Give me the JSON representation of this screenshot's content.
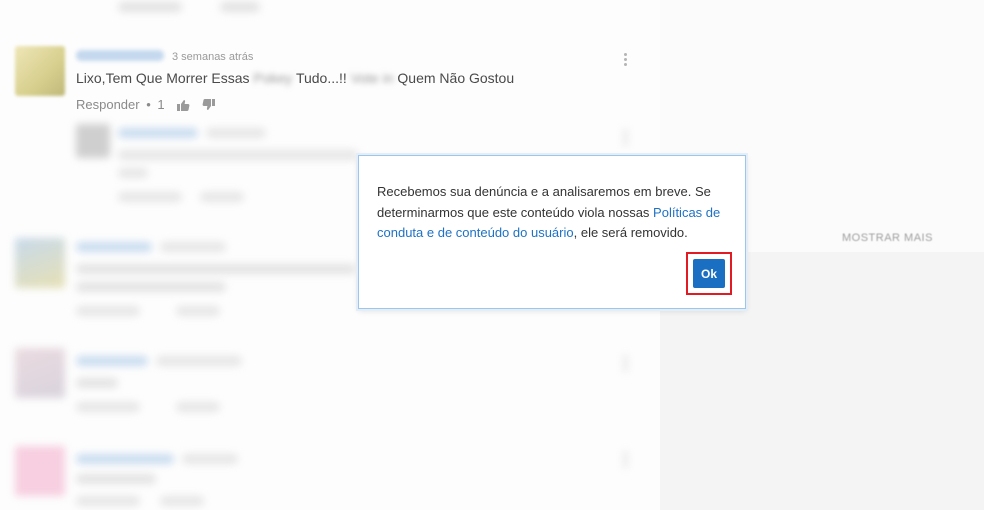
{
  "comment": {
    "time": "3 semanas atrás",
    "text_part1": "Lixo,Tem Que Morrer Essas",
    "text_hidden1": "Pokey",
    "text_part2": "Tudo...!!",
    "text_hidden2": "Vote in",
    "text_part3": "Quem Não Gostou",
    "reply_label": "Responder",
    "bullet": "•",
    "like_count": "1"
  },
  "sidebar": {
    "show_more_label": "MOSTRAR MAIS"
  },
  "dialog": {
    "message_part1": "Recebemos sua denúncia e a analisaremos em breve. Se determinarmos que este conteúdo viola nossas ",
    "policy_link": "Políticas de conduta e de conteúdo do usuário",
    "message_part2": ", ele será removido.",
    "ok_label": "Ok"
  },
  "colors": {
    "accent": "#1b6fc2",
    "link": "#1e72c4",
    "highlight": "#e01b24"
  }
}
